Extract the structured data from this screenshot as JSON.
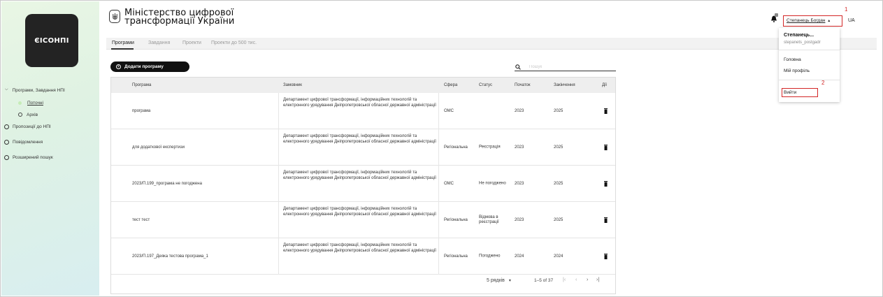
{
  "sidebar": {
    "logo": "ЄІСОНПІ",
    "group": "Програми, Завдання НПІ",
    "sub_items": [
      "Поточні",
      "Архів"
    ],
    "items": [
      "Пропозиції до НПІ",
      "Повідомлення",
      "Розширений пошук"
    ]
  },
  "header": {
    "title_line1": "Міністерство цифрової",
    "title_line2": "трансформації України",
    "crest_icon": "trident-icon"
  },
  "tabs": [
    "Програми",
    "Завдання",
    "Проекти",
    "Проекти до 500 тис."
  ],
  "toolbar": {
    "add_label": "Додати програму",
    "search_placeholder": "Пошук"
  },
  "table": {
    "columns": [
      "Програма",
      "Замовник",
      "Сфера",
      "Статус",
      "Початок",
      "Закінчення",
      "Дії"
    ],
    "rows": [
      {
        "program": "програма",
        "customer": "Департамент цифрової трансформації, інформаційних технологій та електронного урядування Дніпропетровської обласної державної адміністрації",
        "sphere": "ОМС",
        "status": "",
        "start": "2023",
        "end": "2025"
      },
      {
        "program": "для додаткової експертизи",
        "customer": "Департамент цифрової трансформації, інформаційних технологій та електронного урядування Дніпропетровської обласної державної адміністрації",
        "sphere": "Регіональна",
        "status": "Реєстрація",
        "start": "2023",
        "end": "2025"
      },
      {
        "program": "2023/П.199_програма не погоджена",
        "customer": "Департамент цифрової трансформації, інформаційних технологій та електронного урядування Дніпропетровської обласної державної адміністрації",
        "sphere": "ОМС",
        "status": "Не погоджено",
        "start": "2023",
        "end": "2025"
      },
      {
        "program": "тест тест",
        "customer": "Департамент цифрової трансформації, інформаційних технологій та електронного урядування Дніпропетровської обласної державної адміністрації",
        "sphere": "Регіональна",
        "status": "Відмова в реєстрації",
        "start": "2023",
        "end": "2025"
      },
      {
        "program": "2023/П.197_Деяка тестова програма_1",
        "customer": "Департамент цифрової трансформації, інформаційних технологій та електронного урядування Дніпропетровської обласної державної адміністрації",
        "sphere": "Регіональна",
        "status": "Погоджено",
        "start": "2024",
        "end": "2024"
      }
    ],
    "footer": {
      "rows_per_page": "5 рядків",
      "range": "1–5 of 37"
    }
  },
  "user": {
    "name": "Степанець Богдан",
    "lang": "UA",
    "menu_name": "Степанець...",
    "menu_email": "stepanets_postgadr",
    "menu_items": [
      "Головна",
      "Мій профіль",
      "Вийти"
    ],
    "markers": [
      "1",
      "2"
    ]
  },
  "colors": {
    "highlight": "#d32626",
    "button": "#111111",
    "active_dot": "#c6ecb8"
  }
}
